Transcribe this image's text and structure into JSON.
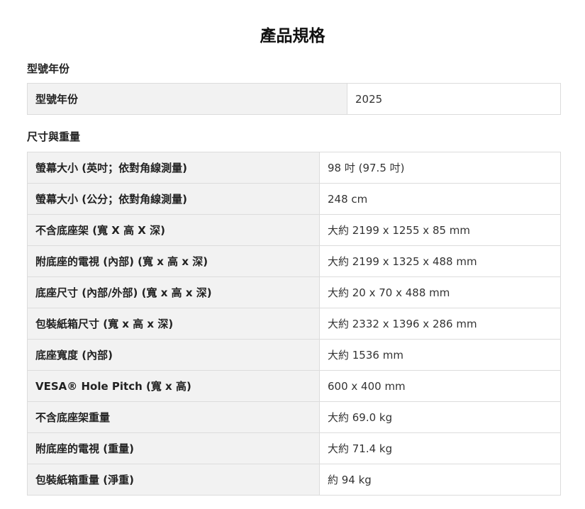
{
  "page_title": "產品規格",
  "sections": [
    {
      "heading": "型號年份",
      "rows": [
        {
          "label": "型號年份",
          "value": "2025"
        }
      ]
    },
    {
      "heading": "尺寸與重量",
      "rows": [
        {
          "label": "螢幕大小 (英吋；依對角線測量)",
          "value": "98 吋 (97.5 吋)"
        },
        {
          "label": "螢幕大小 (公分；依對角線測量)",
          "value": "248 cm"
        },
        {
          "label": "不含底座架 (寬 X 高 X 深)",
          "value": "大約 2199 x 1255 x 85 mm"
        },
        {
          "label": "附底座的電視 (內部) (寬 x 高 x 深)",
          "value": "大約 2199 x 1325 x 488 mm"
        },
        {
          "label": "底座尺寸 (內部/外部) (寬 x 高 x 深)",
          "value": "大約 20 x 70 x 488 mm"
        },
        {
          "label": "包裝紙箱尺寸 (寬 x 高 x 深)",
          "value": "大約 2332 x 1396 x 286 mm"
        },
        {
          "label": "底座寬度 (內部)",
          "value": "大約 1536 mm"
        },
        {
          "label": "VESA® Hole Pitch (寬 x 高)",
          "value": "600 x 400 mm"
        },
        {
          "label": "不含底座架重量",
          "value": "大約 69.0 kg"
        },
        {
          "label": "附底座的電視 (重量)",
          "value": "大約 71.4 kg"
        },
        {
          "label": "包裝紙箱重量 (淨重)",
          "value": "約 94 kg"
        }
      ]
    }
  ]
}
